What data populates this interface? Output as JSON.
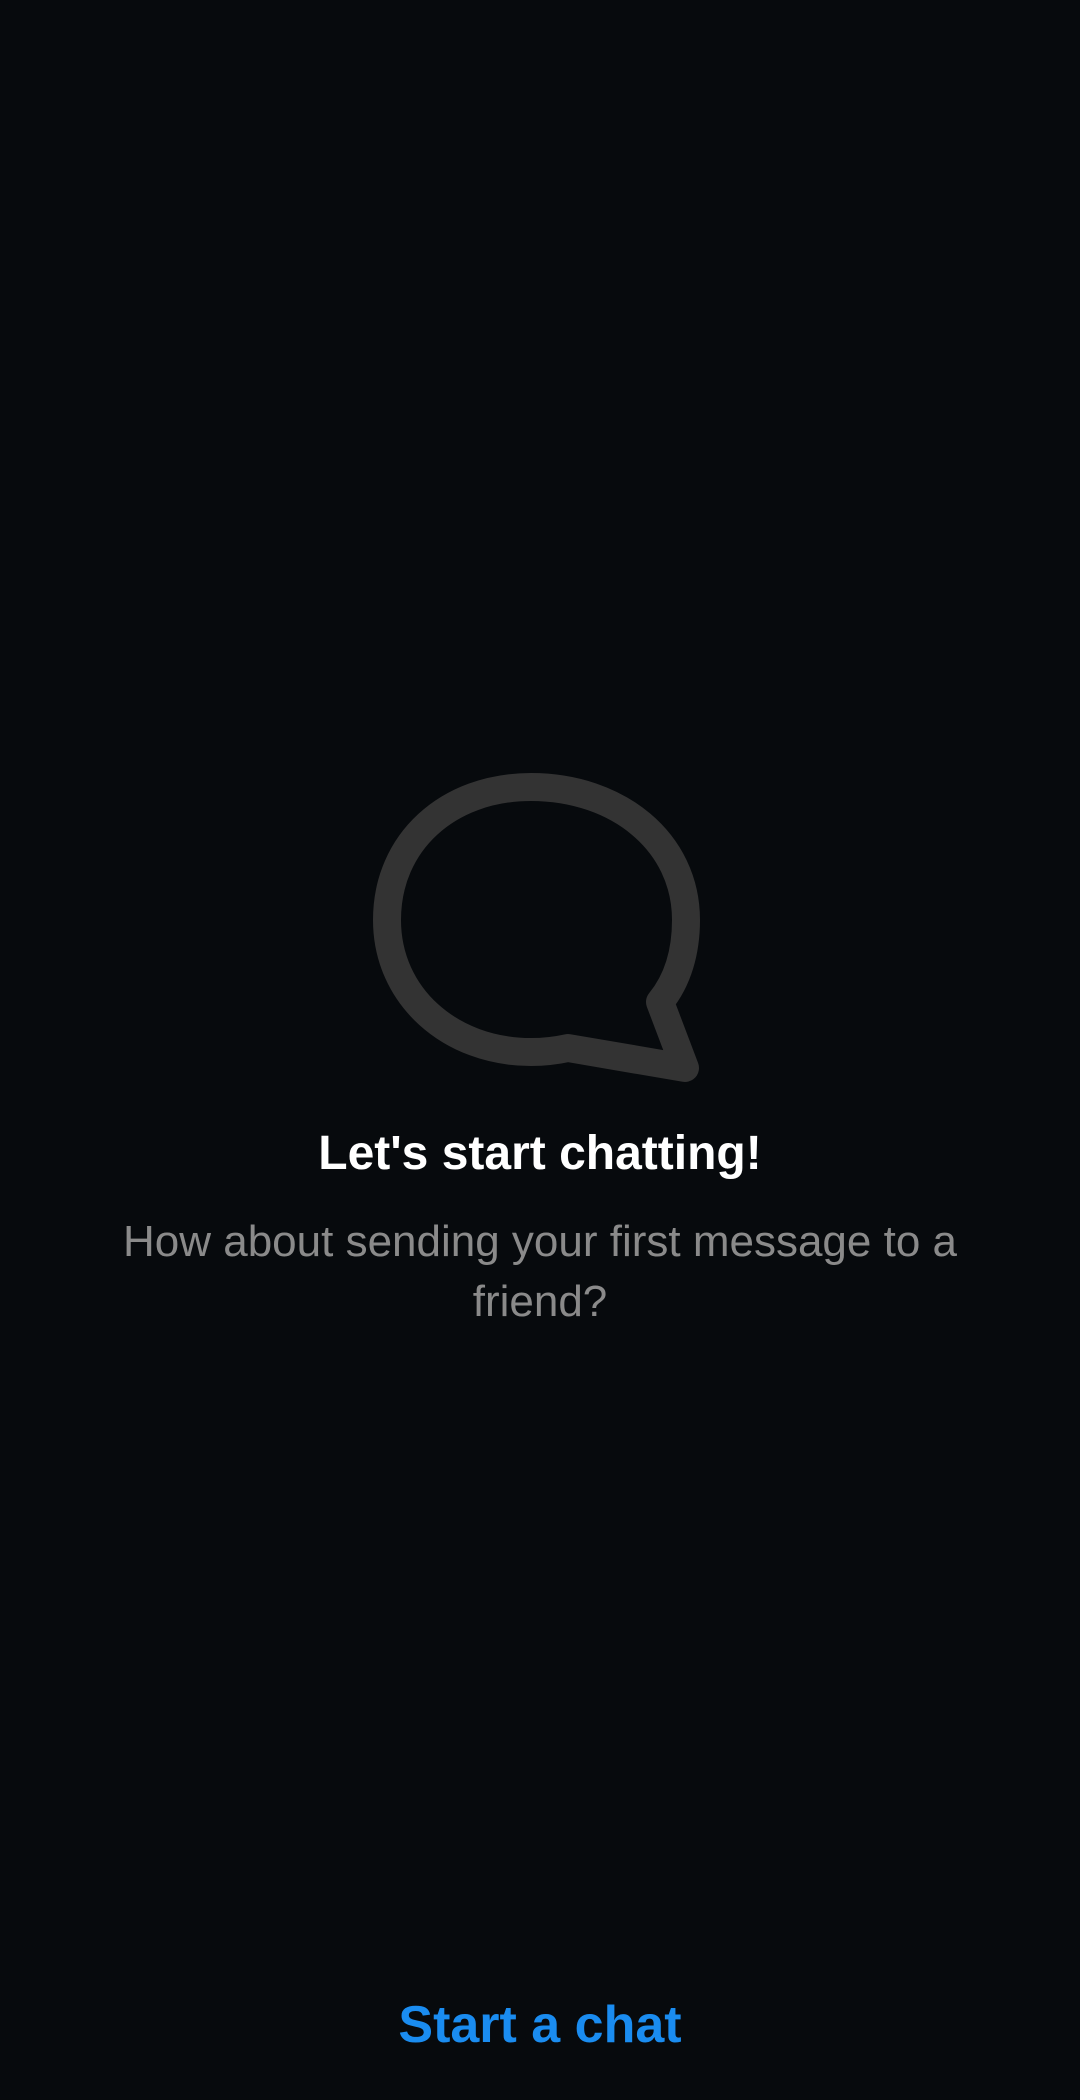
{
  "empty_state": {
    "icon": "chat-bubble-icon",
    "title": "Let's start chatting!",
    "subtitle": "How about sending your first message to a friend?"
  },
  "actions": {
    "start_chat_label": "Start a chat"
  },
  "colors": {
    "background": "#070a0d",
    "icon_stroke": "#333333",
    "title": "#ffffff",
    "subtitle": "#8a8a8a",
    "accent": "#1a8cf0"
  }
}
